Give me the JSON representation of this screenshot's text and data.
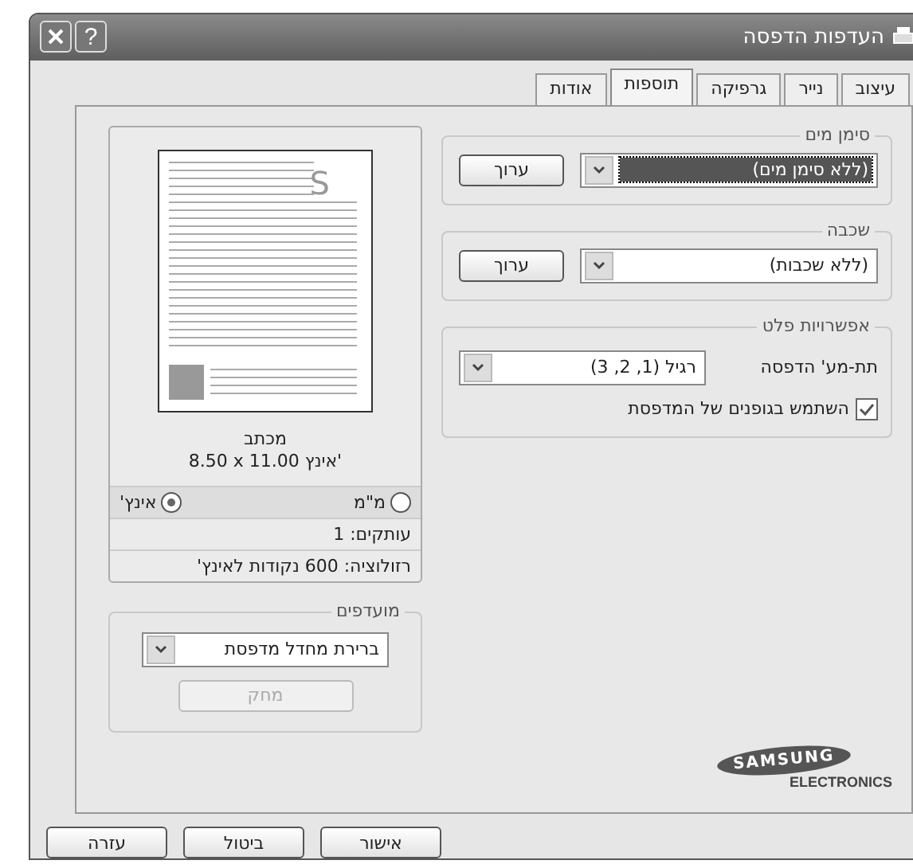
{
  "window": {
    "title": "העדפות הדפסה",
    "help_button": "?"
  },
  "tabs": [
    {
      "label": "עיצוב",
      "selected": false
    },
    {
      "label": "נייר",
      "selected": false
    },
    {
      "label": "גרפיקה",
      "selected": false
    },
    {
      "label": "תוספות",
      "selected": true
    },
    {
      "label": "אודות",
      "selected": false
    }
  ],
  "watermark": {
    "title": "סימן מים",
    "value": "(ללא סימן מים)",
    "focused": true,
    "button": "ערוך"
  },
  "overlay": {
    "title": "שכבה",
    "value": "(ללא שכבות)",
    "focused": false,
    "button": "ערוך"
  },
  "output_options": {
    "title": "אפשרויות פלט",
    "label": "תת-מע' הדפסה",
    "value": "רגיל (1, 2, 3)",
    "checkbox": {
      "label": "השתמש בגופנים של המדפסת",
      "checked": true
    }
  },
  "preview": {
    "sample_letter": "S",
    "paper": "מכתב",
    "size": "8.50 x 11.00 אינץ'",
    "units": [
      {
        "label": "מ\"מ",
        "selected": false
      },
      {
        "label": "אינץ'",
        "selected": true
      }
    ],
    "copies": "עותקים: 1",
    "resolution": "רזולוציה: 600 נקודות לאינץ'"
  },
  "favorites": {
    "title": "מועדפים",
    "value": "ברירת מחדל מדפסת",
    "button": {
      "label": "מחק",
      "disabled": true
    }
  },
  "logo": {
    "brand": "SAMSUNG",
    "subtitle": "ELECTRONICS"
  },
  "buttons": [
    "אישור",
    "ביטול",
    "עזרה"
  ]
}
